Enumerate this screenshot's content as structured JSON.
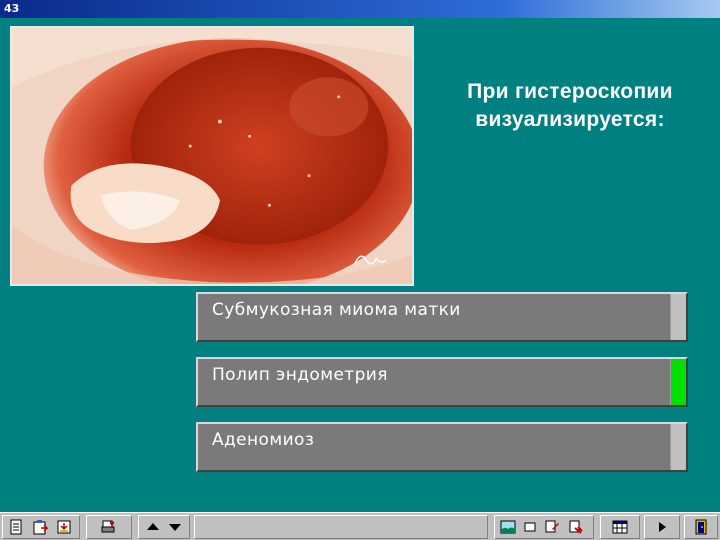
{
  "window": {
    "title": "43"
  },
  "question": {
    "text": "При гистероскопии визуализируется:"
  },
  "answers": [
    {
      "label": "Субмукозная миома матки",
      "correct": false
    },
    {
      "label": "Полип эндометрия",
      "correct": true
    },
    {
      "label": "Аденомиоз",
      "correct": false
    }
  ],
  "toolbar": {
    "left_icons": [
      "notes-icon",
      "clipboard-icon",
      "export-icon",
      "print-icon"
    ],
    "nav_icons": [
      "arrow-up-icon",
      "arrow-down-icon"
    ],
    "right_icons": [
      "image-icon",
      "window-icon",
      "edit-icon",
      "tools-icon",
      "calculator-icon",
      "play-icon",
      "exit-icon"
    ]
  },
  "colors": {
    "background": "#008080",
    "answer_bg": "#7a7a7a",
    "correct_indicator": "#00e000",
    "default_indicator": "#c0c0c0"
  }
}
